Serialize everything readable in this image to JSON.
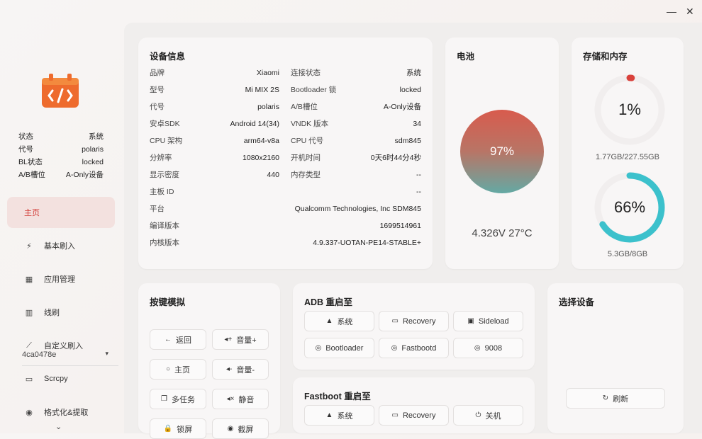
{
  "window": {
    "minimize_icon": "—",
    "close_icon": "✕"
  },
  "sidebar": {
    "status": [
      {
        "label": "状态",
        "value": "系统"
      },
      {
        "label": "代号",
        "value": "polaris"
      },
      {
        "label": "BL状态",
        "value": "locked"
      },
      {
        "label": "A/B槽位",
        "value": "A-Only设备"
      }
    ],
    "nav": [
      {
        "label": "主页",
        "icon": "home-icon"
      },
      {
        "label": "基本刷入",
        "icon": "flash-icon"
      },
      {
        "label": "应用管理",
        "icon": "apps-icon"
      },
      {
        "label": "线刷",
        "icon": "line-flash-icon"
      },
      {
        "label": "自定义刷入",
        "icon": "wand-icon"
      },
      {
        "label": "Scrcpy",
        "icon": "screen-icon"
      },
      {
        "label": "格式化&提取",
        "icon": "user-icon"
      }
    ],
    "more_icon": "⌄"
  },
  "device_info": {
    "title": "设备信息",
    "left": [
      {
        "label": "品牌",
        "value": "Xiaomi"
      },
      {
        "label": "型号",
        "value": "Mi MIX 2S"
      },
      {
        "label": "代号",
        "value": "polaris"
      },
      {
        "label": "安卓SDK",
        "value": "Android 14(34)"
      },
      {
        "label": "CPU 架构",
        "value": "arm64-v8a"
      },
      {
        "label": "分辨率",
        "value": "1080x2160"
      },
      {
        "label": "显示密度",
        "value": "440"
      }
    ],
    "right": [
      {
        "label": "连接状态",
        "value": "系统"
      },
      {
        "label": "Bootloader 锁",
        "value": "locked"
      },
      {
        "label": "A/B槽位",
        "value": "A-Only设备"
      },
      {
        "label": "VNDK 版本",
        "value": "34"
      },
      {
        "label": "CPU 代号",
        "value": "sdm845"
      },
      {
        "label": "开机时间",
        "value": "0天6时44分4秒"
      },
      {
        "label": "内存类型",
        "value": "--"
      }
    ],
    "wide": [
      {
        "label": "主板 ID",
        "value": "--"
      },
      {
        "label": "平台",
        "value": "Qualcomm Technologies, Inc SDM845"
      },
      {
        "label": "编译版本",
        "value": "1699514961"
      },
      {
        "label": "内核版本",
        "value": "4.9.337-UOTAN-PE14-STABLE+"
      }
    ]
  },
  "battery": {
    "title": "电池",
    "level": "97%",
    "stats": "4.326V 27°C",
    "level_fraction": 0.97
  },
  "storage": {
    "title": "存储和内存",
    "storage_percent": "1%",
    "storage_fraction": 0.01,
    "storage_detail": "1.77GB/227.55GB",
    "memory_percent": "66%",
    "memory_fraction": 0.66,
    "memory_detail": "5.3GB/8GB",
    "storage_color": "#d9413b",
    "memory_color": "#3cc1cc"
  },
  "keys": {
    "title": "按键模拟",
    "buttons": [
      {
        "label": "返回",
        "icon": "←"
      },
      {
        "label": "音量+",
        "icon": "◂+"
      },
      {
        "label": "主页",
        "icon": "○"
      },
      {
        "label": "音量-",
        "icon": "◂-"
      },
      {
        "label": "多任务",
        "icon": "❐"
      },
      {
        "label": "静音",
        "icon": "◂×"
      },
      {
        "label": "锁屏",
        "icon": "🔒"
      },
      {
        "label": "截屏",
        "icon": "◉"
      }
    ]
  },
  "adb": {
    "title": "ADB 重启至",
    "buttons": [
      {
        "label": "系统",
        "icon": "▲"
      },
      {
        "label": "Recovery",
        "icon": "▭"
      },
      {
        "label": "Sideload",
        "icon": "▣"
      },
      {
        "label": "Bootloader",
        "icon": "◎"
      },
      {
        "label": "Fastbootd",
        "icon": "◎"
      },
      {
        "label": "9008",
        "icon": "◎"
      }
    ]
  },
  "fastboot": {
    "title": "Fastboot 重启至",
    "buttons": [
      {
        "label": "系统",
        "icon": "▲"
      },
      {
        "label": "Recovery",
        "icon": "▭"
      },
      {
        "label": "关机",
        "icon": "⏻"
      }
    ]
  },
  "device_select": {
    "title": "选择设备",
    "selected": "4ca0478e",
    "arrow": "▾",
    "refresh_label": "刷新",
    "refresh_icon": "↻"
  }
}
